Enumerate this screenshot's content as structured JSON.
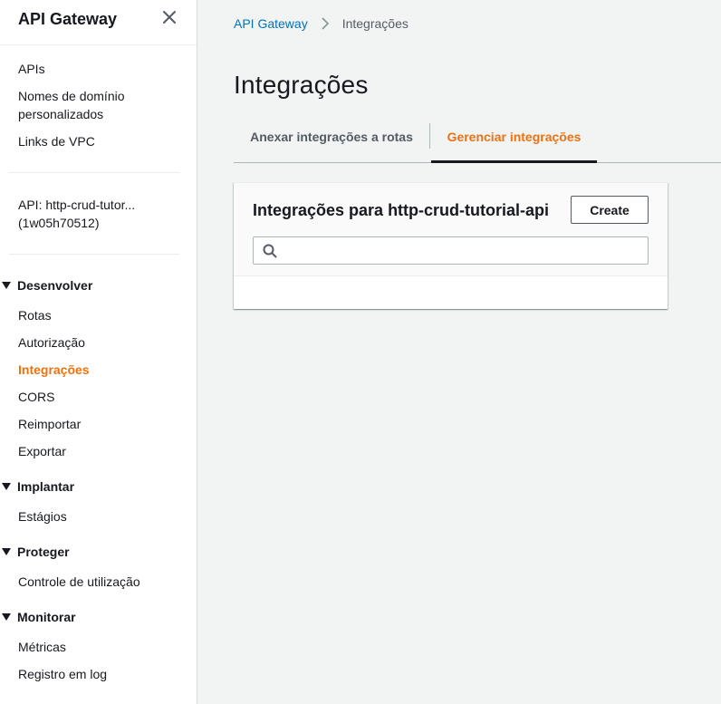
{
  "sidebar": {
    "title": "API Gateway",
    "top_links": [
      "APIs",
      "Nomes de domínio personalizados",
      "Links de VPC"
    ],
    "api_label": "API: http-crud-tutor... (1w05h70512)",
    "sections": [
      {
        "label": "Desenvolver",
        "items": [
          "Rotas",
          "Autorização",
          "Integrações",
          "CORS",
          "Reimportar",
          "Exportar"
        ]
      },
      {
        "label": "Implantar",
        "items": [
          "Estágios"
        ]
      },
      {
        "label": "Proteger",
        "items": [
          "Controle de utilização"
        ]
      },
      {
        "label": "Monitorar",
        "items": [
          "Métricas",
          "Registro em log"
        ]
      }
    ],
    "active_item": "Integrações"
  },
  "breadcrumb": {
    "root": "API Gateway",
    "current": "Integrações"
  },
  "page": {
    "title": "Integrações"
  },
  "tabs": [
    {
      "label": "Anexar integrações a rotas",
      "active": false
    },
    {
      "label": "Gerenciar integrações",
      "active": true
    }
  ],
  "card": {
    "title": "Integrações para http-crud-tutorial-api",
    "create_label": "Create",
    "search_value": "",
    "search_placeholder": ""
  },
  "colors": {
    "accent": "#ec7211",
    "link": "#0073bb",
    "text": "#16191f",
    "background": "#f2f3f3"
  }
}
